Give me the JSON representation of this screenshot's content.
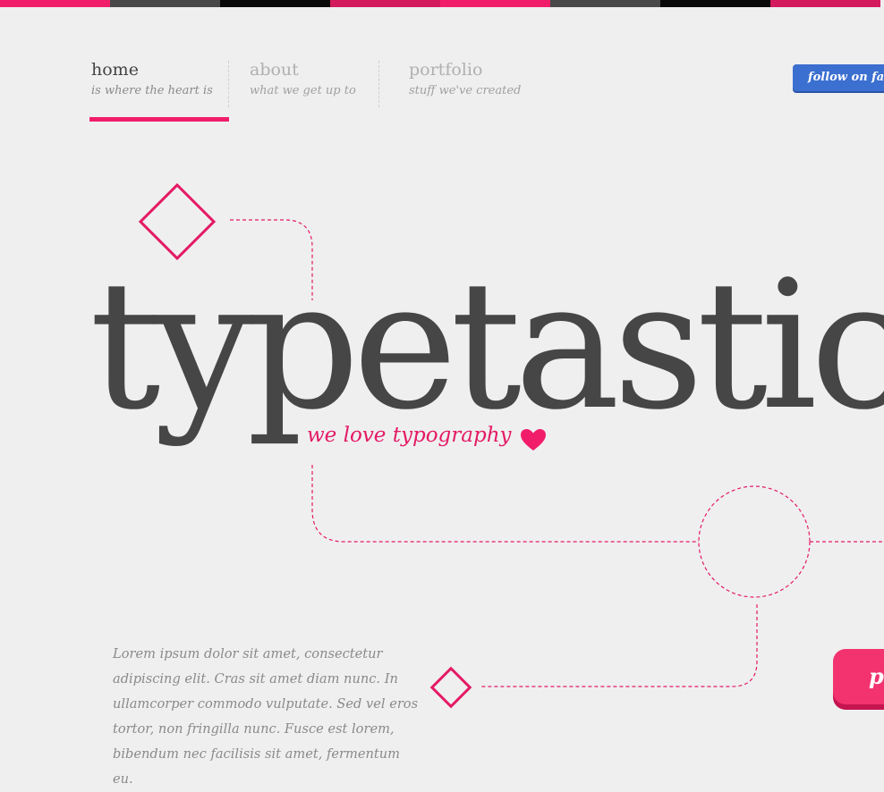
{
  "colors": {
    "accent": "#f21d6a",
    "accent_dark": "#d31a5c",
    "dark": "#464646",
    "black": "#0a0a0a",
    "background": "#efeff0",
    "facebook": "#3b6fd0"
  },
  "topbar": {
    "colors": [
      "#f21d6a",
      "#484848",
      "#0a0a0a",
      "#d31a5c",
      "#f21d6a",
      "#484848",
      "#0a0a0a",
      "#d31a5c"
    ]
  },
  "nav": {
    "items": [
      {
        "title": "home",
        "subtitle": "is where the heart is",
        "active": true
      },
      {
        "title": "about",
        "subtitle": "what we get up to",
        "active": false
      },
      {
        "title": "portfolio",
        "subtitle": "stuff we've created",
        "active": false
      }
    ]
  },
  "social": {
    "facebook_label": "follow on faceb"
  },
  "hero": {
    "title": "typetastic",
    "tagline": "we love typography",
    "tagline_icon": "heart-icon"
  },
  "intro": {
    "text": "Lorem ipsum dolor sit amet, consectetur adipiscing elit. Cras sit amet diam nunc. In ullamcorper commodo vulputate. Sed vel eros tortor, non fringilla nunc. Fusce est lorem, bibendum nec facilisis sit amet, fermentum eu."
  },
  "cta": {
    "label": "p"
  }
}
